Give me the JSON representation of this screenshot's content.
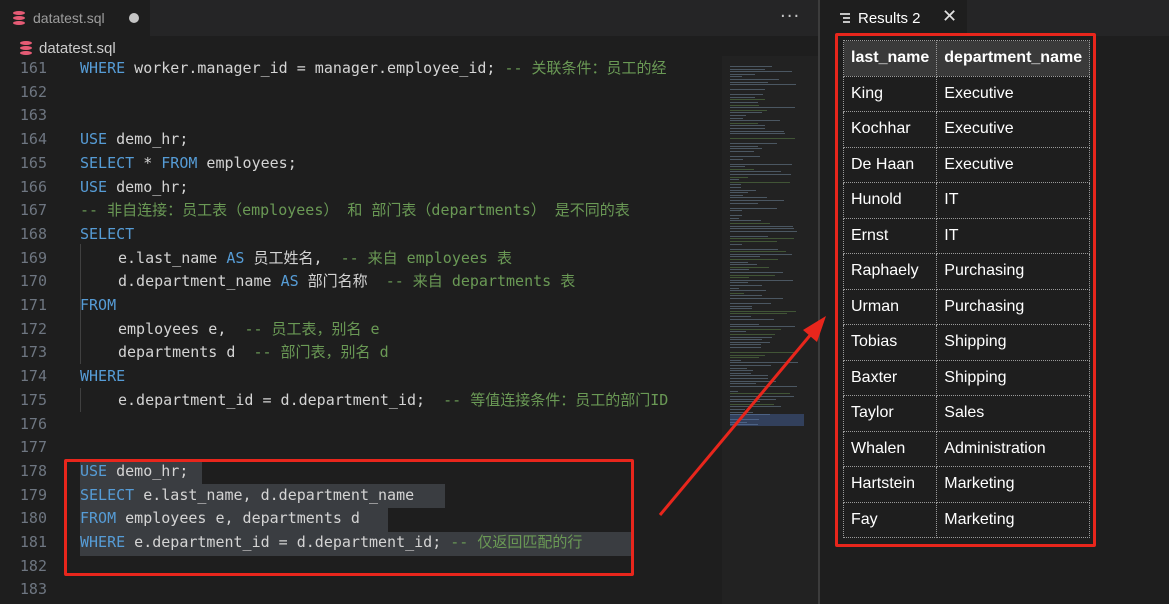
{
  "editor": {
    "tab_title": "datatest.sql",
    "breadcrumb_file": "datatest.sql",
    "more_glyph": "···",
    "lines": [
      {
        "num": "161",
        "indent": false,
        "tokens": [
          {
            "t": "WHERE",
            "c": "kw"
          },
          {
            "t": " worker.manager_id = manager.employee_id; ",
            "c": ""
          },
          {
            "t": "-- 关联条件：员工的经",
            "c": "cm"
          }
        ]
      },
      {
        "num": "162",
        "indent": false,
        "tokens": []
      },
      {
        "num": "163",
        "indent": false,
        "tokens": []
      },
      {
        "num": "164",
        "indent": false,
        "tokens": [
          {
            "t": "USE",
            "c": "kw"
          },
          {
            "t": " demo_hr;",
            "c": ""
          }
        ]
      },
      {
        "num": "165",
        "indent": false,
        "tokens": [
          {
            "t": "SELECT",
            "c": "kw"
          },
          {
            "t": " * ",
            "c": ""
          },
          {
            "t": "FROM",
            "c": "kw"
          },
          {
            "t": " employees;",
            "c": ""
          }
        ]
      },
      {
        "num": "166",
        "indent": false,
        "tokens": [
          {
            "t": "USE",
            "c": "kw"
          },
          {
            "t": " demo_hr;",
            "c": ""
          }
        ]
      },
      {
        "num": "167",
        "indent": false,
        "tokens": [
          {
            "t": "-- 非自连接：员工表（employees） 和 部门表（departments） 是不同的表",
            "c": "cm"
          }
        ]
      },
      {
        "num": "168",
        "indent": false,
        "tokens": [
          {
            "t": "SELECT",
            "c": "kw"
          }
        ]
      },
      {
        "num": "169",
        "indent": true,
        "tokens": [
          {
            "t": "e.last_name ",
            "c": ""
          },
          {
            "t": "AS",
            "c": "kw"
          },
          {
            "t": " 员工姓名,  ",
            "c": ""
          },
          {
            "t": "-- 来自 employees 表",
            "c": "cm"
          }
        ]
      },
      {
        "num": "170",
        "indent": true,
        "tokens": [
          {
            "t": "d.department_name ",
            "c": ""
          },
          {
            "t": "AS",
            "c": "kw"
          },
          {
            "t": " 部门名称  ",
            "c": ""
          },
          {
            "t": "-- 来自 departments 表",
            "c": "cm"
          }
        ]
      },
      {
        "num": "171",
        "indent": false,
        "tokens": [
          {
            "t": "FROM",
            "c": "kw"
          }
        ]
      },
      {
        "num": "172",
        "indent": true,
        "tokens": [
          {
            "t": "employees e,  ",
            "c": ""
          },
          {
            "t": "-- 员工表，别名 e",
            "c": "cm"
          }
        ]
      },
      {
        "num": "173",
        "indent": true,
        "tokens": [
          {
            "t": "departments d  ",
            "c": ""
          },
          {
            "t": "-- 部门表，别名 d",
            "c": "cm"
          }
        ]
      },
      {
        "num": "174",
        "indent": false,
        "tokens": [
          {
            "t": "WHERE",
            "c": "kw"
          }
        ]
      },
      {
        "num": "175",
        "indent": true,
        "tokens": [
          {
            "t": "e.department_id = d.department_id;  ",
            "c": ""
          },
          {
            "t": "-- 等值连接条件：员工的部门ID",
            "c": "cm"
          }
        ]
      },
      {
        "num": "176",
        "indent": false,
        "tokens": []
      },
      {
        "num": "177",
        "indent": false,
        "tokens": []
      },
      {
        "num": "178",
        "indent": false,
        "tokens": [
          {
            "t": "USE",
            "c": "kw"
          },
          {
            "t": " demo_hr;",
            "c": ""
          }
        ]
      },
      {
        "num": "179",
        "indent": false,
        "tokens": [
          {
            "t": "SELECT",
            "c": "kw"
          },
          {
            "t": " e.last_name, d.department_name",
            "c": ""
          }
        ]
      },
      {
        "num": "180",
        "indent": false,
        "tokens": [
          {
            "t": "FROM",
            "c": "kw"
          },
          {
            "t": " employees e, departments d",
            "c": ""
          }
        ]
      },
      {
        "num": "181",
        "indent": false,
        "tokens": [
          {
            "t": "WHERE",
            "c": "kw"
          },
          {
            "t": " e.department_id = d.department_id; ",
            "c": ""
          },
          {
            "t": "-- 仅返回匹配的行",
            "c": "cm"
          }
        ]
      },
      {
        "num": "182",
        "indent": false,
        "tokens": []
      },
      {
        "num": "183",
        "indent": false,
        "tokens": []
      }
    ]
  },
  "results": {
    "tab_title": "Results 2",
    "close_glyph": "✕",
    "columns": [
      "last_name",
      "department_name"
    ],
    "rows": [
      [
        "King",
        "Executive"
      ],
      [
        "Kochhar",
        "Executive"
      ],
      [
        "De Haan",
        "Executive"
      ],
      [
        "Hunold",
        "IT"
      ],
      [
        "Ernst",
        "IT"
      ],
      [
        "Raphaely",
        "Purchasing"
      ],
      [
        "Urman",
        "Purchasing"
      ],
      [
        "Tobias",
        "Shipping"
      ],
      [
        "Baxter",
        "Shipping"
      ],
      [
        "Taylor",
        "Sales"
      ],
      [
        "Whalen",
        "Administration"
      ],
      [
        "Hartstein",
        "Marketing"
      ],
      [
        "Fay",
        "Marketing"
      ]
    ]
  },
  "colors": {
    "keyword": "#569cd6",
    "comment": "#6a9955",
    "text": "#d4d4d4",
    "annotation_red": "#e8261c",
    "sql_file_icon": "#e55b75"
  },
  "icons": {
    "file": "database-icon",
    "results": "list-icon",
    "close": "close-icon",
    "more": "more-actions-icon",
    "dirty": "unsaved-dot-icon"
  }
}
